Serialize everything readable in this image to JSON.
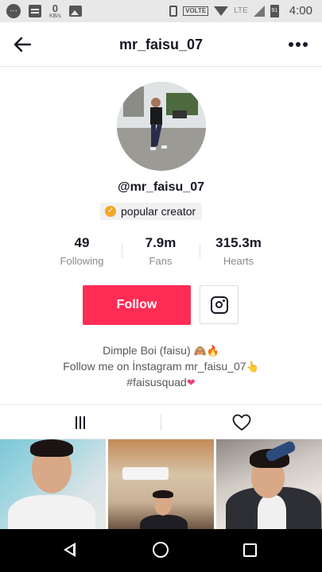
{
  "status_bar": {
    "data_speed": "0",
    "data_unit": "KB/s",
    "network_label": "VOLTE",
    "lte_label": "LTE",
    "battery": "91",
    "time": "4:00"
  },
  "header": {
    "title": "mr_faisu_07",
    "back_icon": "arrow-left-icon",
    "more_icon": "more-horizontal-icon"
  },
  "profile": {
    "username": "@mr_faisu_07",
    "badge": "popular creator",
    "badge_color": "#f6a623"
  },
  "stats": [
    {
      "value": "49",
      "label": "Following"
    },
    {
      "value": "7.9m",
      "label": "Fans"
    },
    {
      "value": "315.3m",
      "label": "Hearts"
    }
  ],
  "actions": {
    "follow_label": "Follow",
    "follow_color": "#fe2c55",
    "instagram_icon": "instagram-icon"
  },
  "bio": {
    "line1": "Dimple Boi (faisu)",
    "line1_emoji": "🙈🔥",
    "line2": "Follow me on İnstagram mr_faisu_07",
    "line2_emoji": "👆",
    "line3": "#faisusquad",
    "line3_emoji": "❤"
  },
  "tabs": {
    "videos_icon": "grid-icon",
    "liked_icon": "heart-outline-icon"
  },
  "nav": {
    "back_icon": "nav-back-icon",
    "home_icon": "nav-home-icon",
    "recents_icon": "nav-recents-icon"
  }
}
